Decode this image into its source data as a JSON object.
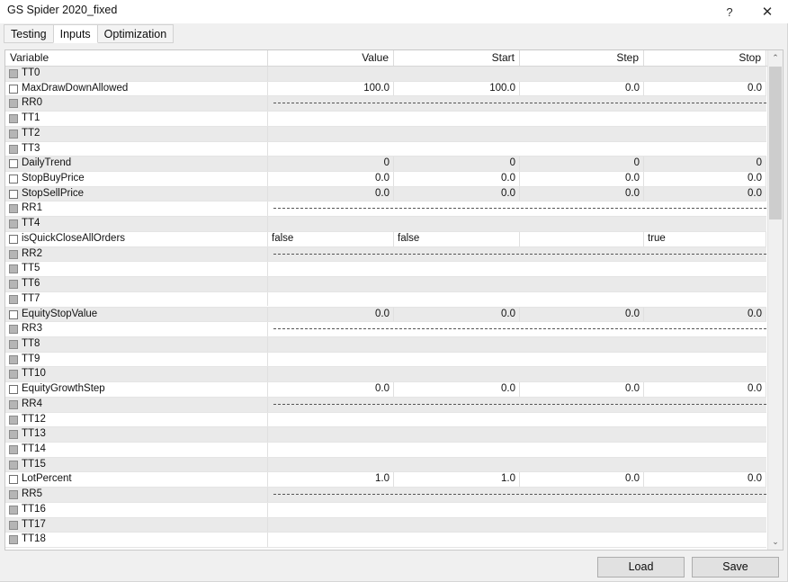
{
  "window": {
    "title": "GS Spider 2020_fixed",
    "help_label": "?",
    "close_label": "✕"
  },
  "tabs": [
    {
      "label": "Testing",
      "active": false
    },
    {
      "label": "Inputs",
      "active": true
    },
    {
      "label": "Optimization",
      "active": false
    }
  ],
  "grid": {
    "columns": [
      {
        "label": "Variable",
        "align": "left"
      },
      {
        "label": "Value",
        "align": "right"
      },
      {
        "label": "Start",
        "align": "right"
      },
      {
        "label": "Step",
        "align": "right"
      },
      {
        "label": "Stop",
        "align": "right"
      }
    ],
    "rows": [
      {
        "name": "TT0",
        "checkbox": "dim",
        "kind": "blank",
        "values": [
          "",
          "",
          "",
          ""
        ]
      },
      {
        "name": "MaxDrawDownAllowed",
        "checkbox": "empty",
        "kind": "numeric",
        "values": [
          "100.0",
          "100.0",
          "0.0",
          "0.0"
        ]
      },
      {
        "name": "RR0",
        "checkbox": "dim",
        "kind": "separator",
        "values": [
          "",
          "",
          "",
          ""
        ]
      },
      {
        "name": "TT1",
        "checkbox": "dim",
        "kind": "blank",
        "values": [
          "",
          "",
          "",
          ""
        ]
      },
      {
        "name": "TT2",
        "checkbox": "dim",
        "kind": "blank",
        "values": [
          "",
          "",
          "",
          ""
        ]
      },
      {
        "name": "TT3",
        "checkbox": "dim",
        "kind": "blank",
        "values": [
          "",
          "",
          "",
          ""
        ]
      },
      {
        "name": "DailyTrend",
        "checkbox": "empty",
        "kind": "numeric",
        "values": [
          "0",
          "0",
          "0",
          "0"
        ]
      },
      {
        "name": "StopBuyPrice",
        "checkbox": "empty",
        "kind": "numeric",
        "values": [
          "0.0",
          "0.0",
          "0.0",
          "0.0"
        ]
      },
      {
        "name": "StopSellPrice",
        "checkbox": "empty",
        "kind": "numeric",
        "values": [
          "0.0",
          "0.0",
          "0.0",
          "0.0"
        ]
      },
      {
        "name": "RR1",
        "checkbox": "dim",
        "kind": "separator",
        "values": [
          "",
          "",
          "",
          ""
        ]
      },
      {
        "name": "TT4",
        "checkbox": "dim",
        "kind": "blank",
        "values": [
          "",
          "",
          "",
          ""
        ]
      },
      {
        "name": "isQuickCloseAllOrders",
        "checkbox": "empty",
        "kind": "text",
        "values": [
          "false",
          "false",
          "",
          "true"
        ]
      },
      {
        "name": "RR2",
        "checkbox": "dim",
        "kind": "separator",
        "values": [
          "",
          "",
          "",
          ""
        ]
      },
      {
        "name": "TT5",
        "checkbox": "dim",
        "kind": "blank",
        "values": [
          "",
          "",
          "",
          ""
        ]
      },
      {
        "name": "TT6",
        "checkbox": "dim",
        "kind": "blank",
        "values": [
          "",
          "",
          "",
          ""
        ]
      },
      {
        "name": "TT7",
        "checkbox": "dim",
        "kind": "blank",
        "values": [
          "",
          "",
          "",
          ""
        ]
      },
      {
        "name": "EquityStopValue",
        "checkbox": "empty",
        "kind": "numeric",
        "values": [
          "0.0",
          "0.0",
          "0.0",
          "0.0"
        ]
      },
      {
        "name": "RR3",
        "checkbox": "dim",
        "kind": "separator",
        "values": [
          "",
          "",
          "",
          ""
        ]
      },
      {
        "name": "TT8",
        "checkbox": "dim",
        "kind": "blank",
        "values": [
          "",
          "",
          "",
          ""
        ]
      },
      {
        "name": "TT9",
        "checkbox": "dim",
        "kind": "blank",
        "values": [
          "",
          "",
          "",
          ""
        ]
      },
      {
        "name": "TT10",
        "checkbox": "dim",
        "kind": "blank",
        "values": [
          "",
          "",
          "",
          ""
        ]
      },
      {
        "name": "EquityGrowthStep",
        "checkbox": "empty",
        "kind": "numeric",
        "values": [
          "0.0",
          "0.0",
          "0.0",
          "0.0"
        ]
      },
      {
        "name": "RR4",
        "checkbox": "dim",
        "kind": "separator",
        "values": [
          "",
          "",
          "",
          ""
        ]
      },
      {
        "name": "TT12",
        "checkbox": "dim",
        "kind": "blank",
        "values": [
          "",
          "",
          "",
          ""
        ]
      },
      {
        "name": "TT13",
        "checkbox": "dim",
        "kind": "blank",
        "values": [
          "",
          "",
          "",
          ""
        ]
      },
      {
        "name": "TT14",
        "checkbox": "dim",
        "kind": "blank",
        "values": [
          "",
          "",
          "",
          ""
        ]
      },
      {
        "name": "TT15",
        "checkbox": "dim",
        "kind": "blank",
        "values": [
          "",
          "",
          "",
          ""
        ]
      },
      {
        "name": "LotPercent",
        "checkbox": "empty",
        "kind": "numeric",
        "values": [
          "1.0",
          "1.0",
          "0.0",
          "0.0"
        ]
      },
      {
        "name": "RR5",
        "checkbox": "dim",
        "kind": "separator",
        "values": [
          "",
          "",
          "",
          ""
        ]
      },
      {
        "name": "TT16",
        "checkbox": "dim",
        "kind": "blank",
        "values": [
          "",
          "",
          "",
          ""
        ]
      },
      {
        "name": "TT17",
        "checkbox": "dim",
        "kind": "blank",
        "values": [
          "",
          "",
          "",
          ""
        ]
      },
      {
        "name": "TT18",
        "checkbox": "dim",
        "kind": "blank",
        "values": [
          "",
          "",
          "",
          ""
        ]
      }
    ]
  },
  "scrollbar": {
    "up_glyph": "⌃",
    "down_glyph": "⌄"
  },
  "footer": {
    "load_label": "Load",
    "save_label": "Save"
  },
  "layout": {
    "column_edges": [
      0,
      292,
      432,
      572,
      710,
      846
    ]
  }
}
